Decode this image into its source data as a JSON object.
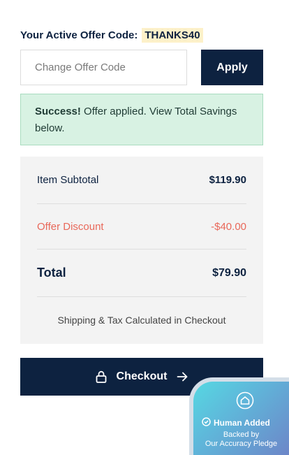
{
  "offer": {
    "label": "Your Active Offer Code:",
    "code": "THANKS40",
    "input_placeholder": "Change Offer Code",
    "apply_label": "Apply"
  },
  "alert": {
    "strong": "Success!",
    "message": " Offer applied. View Total Savings below."
  },
  "summary": {
    "subtotal_label": "Item Subtotal",
    "subtotal_value": "$119.90",
    "discount_label": "Offer Discount",
    "discount_value": "-$40.00",
    "total_label": "Total",
    "total_value": "$79.90",
    "shipping_note": "Shipping & Tax Calculated in Checkout"
  },
  "checkout": {
    "label": "Checkout",
    "lock_icon": "lock-icon",
    "arrow_icon": "arrow-right-icon"
  },
  "badge": {
    "title": "Human Added",
    "line1": "Backed by",
    "line2": "Our Accuracy Pledge",
    "house_icon": "house-icon",
    "check_icon": "check-circle-icon"
  },
  "colors": {
    "navy": "#0d2240",
    "discount_red": "#e9685a",
    "success_bg": "#d8f2e3",
    "code_highlight": "#fdf1c9",
    "summary_bg": "#f3f3f3"
  }
}
